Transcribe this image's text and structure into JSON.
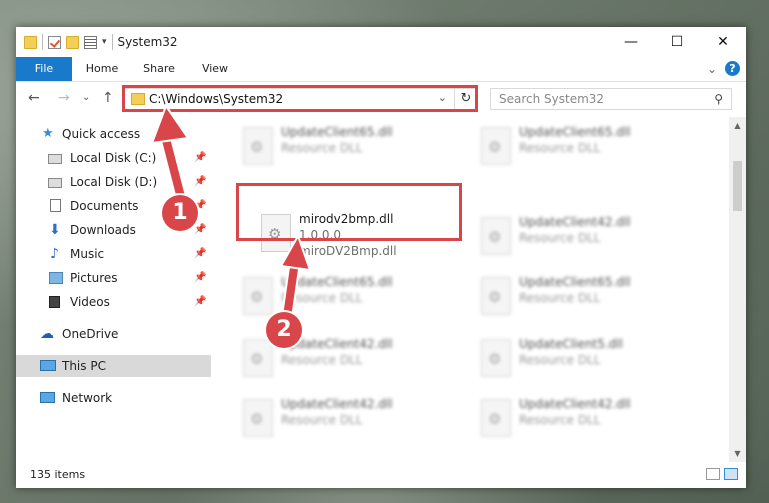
{
  "window": {
    "title": "System32",
    "controls": {
      "minimize": "—",
      "maximize": "☐",
      "close": "✕"
    }
  },
  "ribbon": {
    "tabs": [
      "File",
      "Home",
      "Share",
      "View"
    ],
    "expand_glyph": "⌄",
    "help_label": "?"
  },
  "nav": {
    "back": "←",
    "forward": "→",
    "recent": "⌄",
    "up": "↑",
    "address": "C:\\Windows\\System32",
    "address_dropdown": "⌄",
    "refresh": "↻",
    "search_placeholder": "Search System32",
    "search_glyph": "⚲"
  },
  "sidebar": {
    "items": [
      {
        "label": "Quick access",
        "icon": "star-icon",
        "pinned": false
      },
      {
        "label": "Local Disk (C:)",
        "icon": "drive-icon",
        "pinned": true
      },
      {
        "label": "Local Disk (D:)",
        "icon": "drive-icon",
        "pinned": true
      },
      {
        "label": "Documents",
        "icon": "documents-icon",
        "pinned": true
      },
      {
        "label": "Downloads",
        "icon": "download-icon",
        "pinned": true
      },
      {
        "label": "Music",
        "icon": "music-icon",
        "pinned": true
      },
      {
        "label": "Pictures",
        "icon": "pictures-icon",
        "pinned": true
      },
      {
        "label": "Videos",
        "icon": "videos-icon",
        "pinned": true
      },
      {
        "label": "OneDrive",
        "icon": "cloud-icon",
        "pinned": false
      },
      {
        "label": "This PC",
        "icon": "computer-icon",
        "pinned": false
      },
      {
        "label": "Network",
        "icon": "network-icon",
        "pinned": false
      }
    ],
    "pin_glyph": "📌"
  },
  "files": [
    {
      "name": "UpdateClient65.dll",
      "line2": "Resource DLL",
      "line3": "",
      "blurred": true
    },
    {
      "name": "UpdateClient65.dll",
      "line2": "Resource DLL",
      "line3": "",
      "blurred": true
    },
    {
      "name": "mirodv2bmp.dll",
      "line2": "1.0.0.0",
      "line3": "miroDV2Bmp.dll",
      "blurred": false
    },
    {
      "name": "UpdateClient42.dll",
      "line2": "Resource DLL",
      "line3": "",
      "blurred": true
    },
    {
      "name": "UpdateClient65.dll",
      "line2": "Resource DLL",
      "line3": "",
      "blurred": true
    },
    {
      "name": "UpdateClient65.dll",
      "line2": "Resource DLL",
      "line3": "",
      "blurred": true
    },
    {
      "name": "UpdateClient42.dll",
      "line2": "Resource DLL",
      "line3": "",
      "blurred": true
    },
    {
      "name": "UpdateClient5.dll",
      "line2": "Resource DLL",
      "line3": "",
      "blurred": true
    },
    {
      "name": "UpdateClient42.dll",
      "line2": "Resource DLL",
      "line3": "",
      "blurred": true
    },
    {
      "name": "UpdateClient42.dll",
      "line2": "Resource DLL",
      "line3": "",
      "blurred": true
    }
  ],
  "status": {
    "item_count": "135 items"
  },
  "annotations": {
    "callout_1": "1",
    "callout_2": "2",
    "color": "#d9464a"
  }
}
